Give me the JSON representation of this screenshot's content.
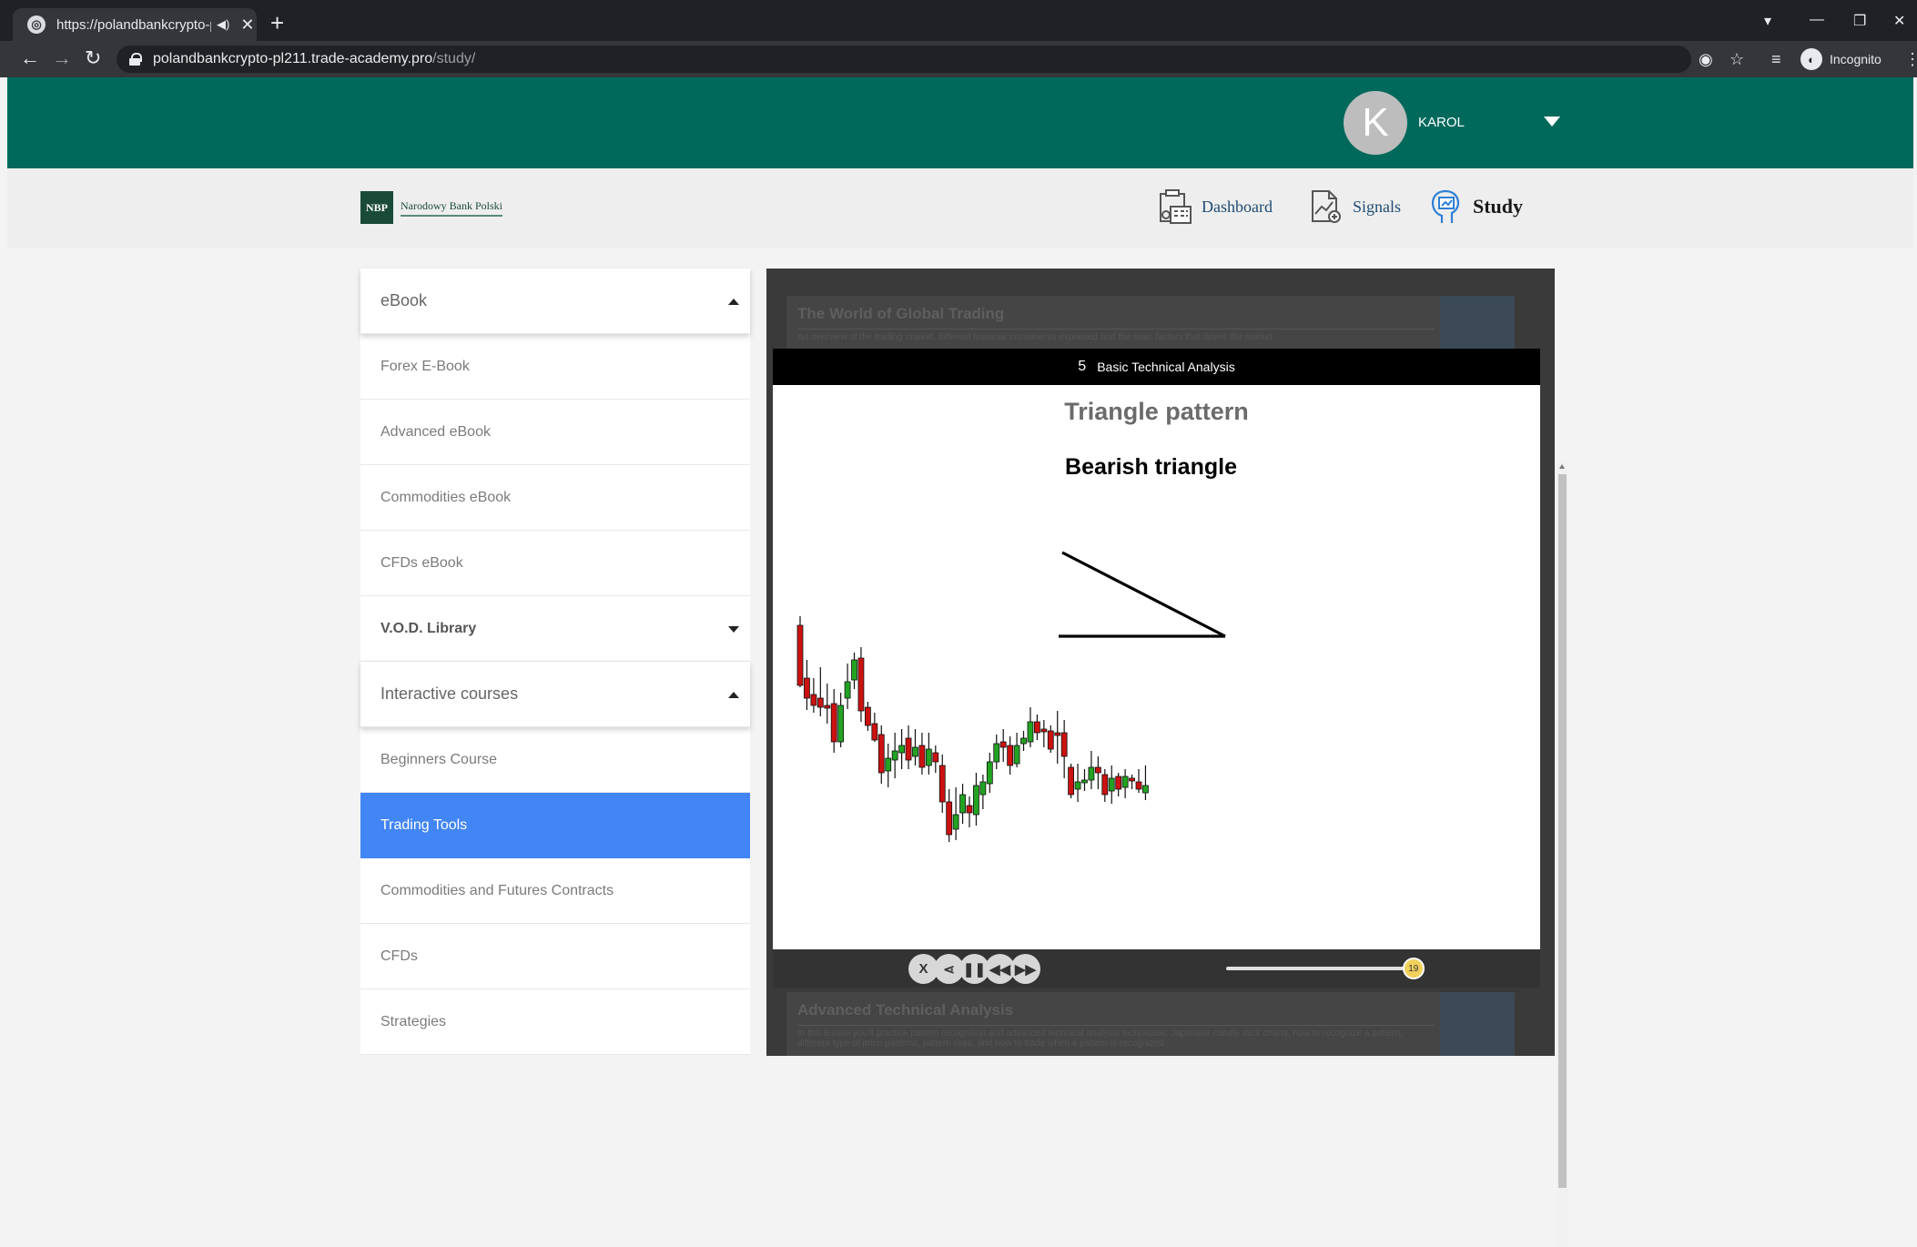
{
  "browser": {
    "tab_title": "https://polandbankcrypto-pl",
    "url_host": "polandbankcrypto-pl211.trade-academy.pro",
    "url_path": "/study/",
    "incognito_label": "Incognito"
  },
  "user": {
    "initial": "K",
    "name": "KAROL"
  },
  "logo": {
    "badge": "NBP",
    "name": "Narodowy Bank Polski"
  },
  "nav": [
    {
      "label": "Dashboard",
      "icon": "dashboard-icon"
    },
    {
      "label": "Signals",
      "icon": "signals-icon"
    },
    {
      "label": "Study",
      "icon": "study-icon"
    }
  ],
  "sidebar": {
    "ebook_header": "eBook",
    "ebook_items": [
      "Forex E-Book",
      "Advanced eBook",
      "Commodities eBook",
      "CFDs eBook"
    ],
    "vod_header": "V.O.D. Library",
    "courses_header": "Interactive courses",
    "course_items": [
      "Beginners Course",
      "Trading Tools",
      "Commodities and Futures Contracts",
      "CFDs",
      "Strategies"
    ],
    "active_item": "Trading Tools"
  },
  "player": {
    "bg_card_1_title": "The World of Global Trading",
    "bg_card_1_desc": "An overview of the trading market, different financial instruments explained and the main factors that drives the market",
    "bg_card_2_title": "Advanced Technical Analysis",
    "bg_card_2_desc": "In this lesson you'll practice pattern recognition and advanced technical analysis techniques: Japanese candle stick charts, how to recognize a pattern, different type of price patterns, pattern risks, and how to trade when a pattern is recognized",
    "lesson_number": "5",
    "lesson_title": "Basic Technical Analysis",
    "slide_title": "Triangle pattern",
    "slide_subtitle": "Bearish triangle",
    "controls": [
      "X",
      "share",
      "pause",
      "rewind",
      "forward"
    ],
    "progress_value": "19",
    "progress_fraction": 0.98
  },
  "colors": {
    "brand_green": "#00695c",
    "active_blue": "#4285f4",
    "bull_candle": "#22a322",
    "bear_candle": "#cc1111"
  }
}
